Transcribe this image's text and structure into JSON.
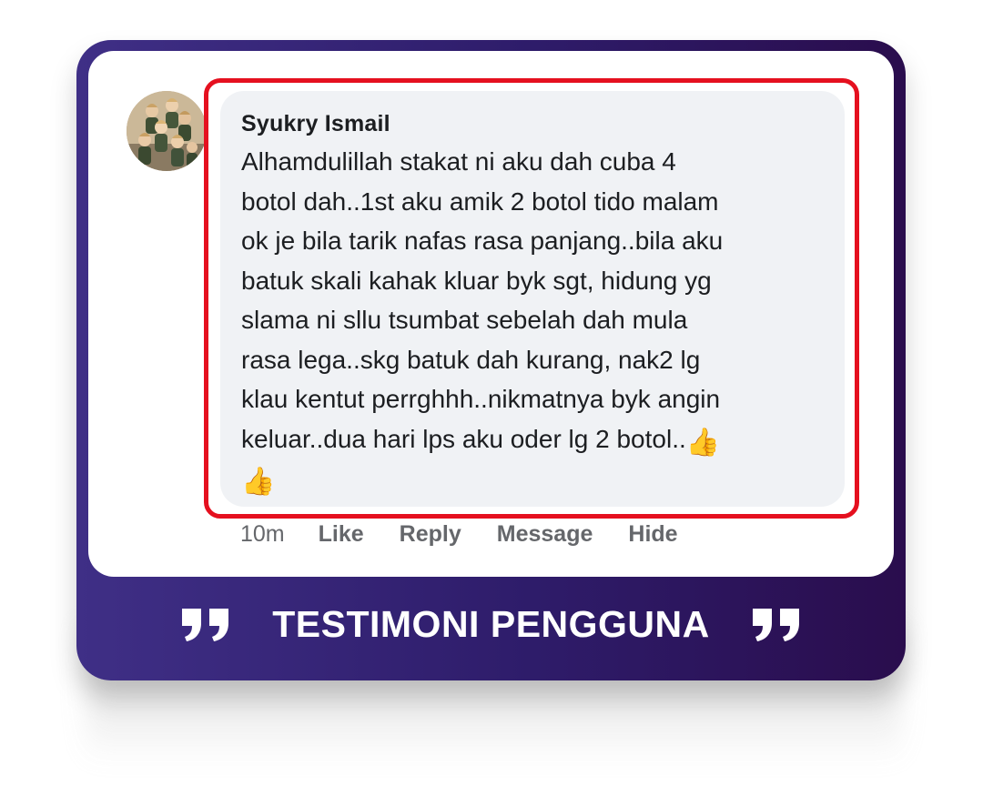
{
  "comment": {
    "author": "Syukry Ismail",
    "text": "Alhamdulillah stakat ni aku dah cuba 4\nbotol dah..1st aku amik 2 botol tido malam\nok je bila tarik nafas rasa panjang..bila aku\nbatuk skali kahak kluar byk sgt, hidung yg\nslama ni sllu tsumbat sebelah dah mula\nrasa lega..skg batuk dah kurang, nak2 lg\nklau kentut perrghhh..nikmatnya byk angin\nkeluar..dua hari lps aku oder lg 2 botol..",
    "emoji_1": "👍",
    "emoji_2": "👍",
    "time": "10m",
    "actions": {
      "like": "Like",
      "reply": "Reply",
      "message": "Message",
      "hide": "Hide"
    }
  },
  "banner": {
    "title": "TESTIMONI PENGGUNA",
    "left_icon": "open-quote-icon",
    "right_icon": "close-quote-icon"
  },
  "colors": {
    "frame_start": "#3f2f86",
    "frame_end": "#2a0d4d",
    "highlight": "#e5101f",
    "bubble": "#f0f2f5"
  }
}
